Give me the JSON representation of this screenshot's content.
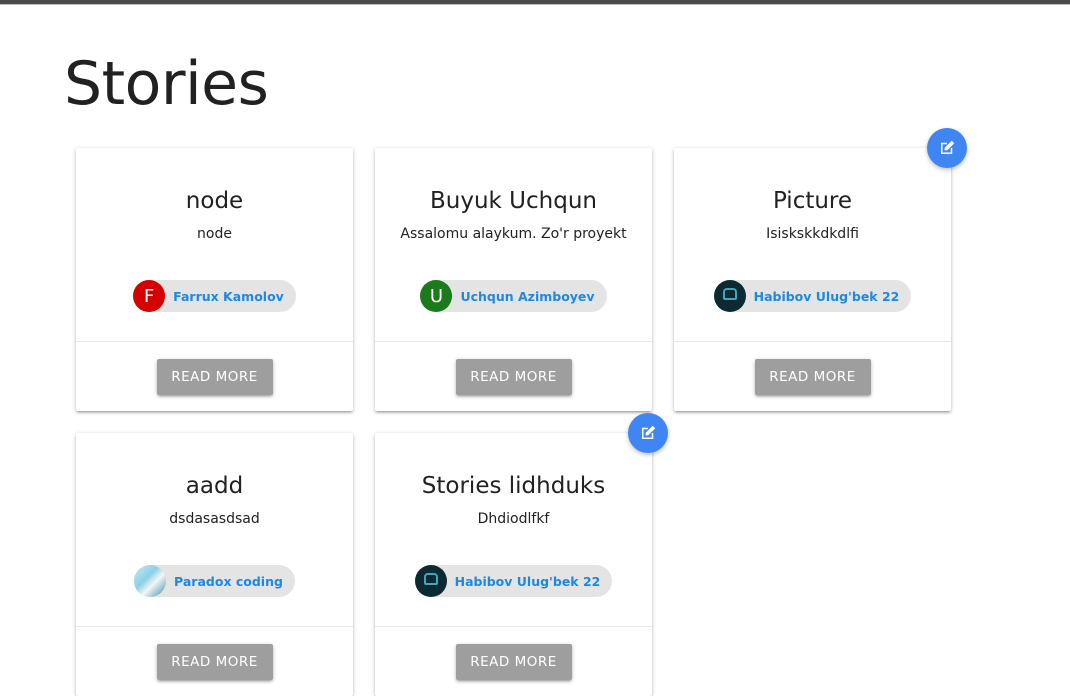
{
  "page": {
    "title": "Stories"
  },
  "read_more_label": "Read more",
  "stories": [
    {
      "title": "node",
      "text": "node",
      "author": "Farrux Kamolov",
      "avatar_letter": "F",
      "avatar_color": "#d50000",
      "editable": false
    },
    {
      "title": "Buyuk Uchqun",
      "text": "Assalomu alaykum. Zo'r proyekt",
      "author": "Uchqun Azimboyev",
      "avatar_letter": "U",
      "avatar_color": "#1b7b1b",
      "editable": false
    },
    {
      "title": "Picture",
      "text": "Isiskskkdkdlfi",
      "author": "Habibov Ulug'bek 22",
      "avatar_letter": "",
      "avatar_color": "#0d2a33",
      "editable": true
    },
    {
      "title": "aadd",
      "text": "dsdasasdsad",
      "author": "Paradox coding",
      "avatar_letter": "",
      "avatar_color": "#8ad0e6",
      "editable": false
    },
    {
      "title": "Stories lidhduks",
      "text": "Dhdiodlfkf",
      "author": "Habibov Ulug'bek 22",
      "avatar_letter": "",
      "avatar_color": "#0d2a33",
      "editable": true
    }
  ],
  "colors": {
    "accent": "#3f86f4",
    "chip_text": "#1e88e5",
    "button": "#9e9e9e"
  }
}
